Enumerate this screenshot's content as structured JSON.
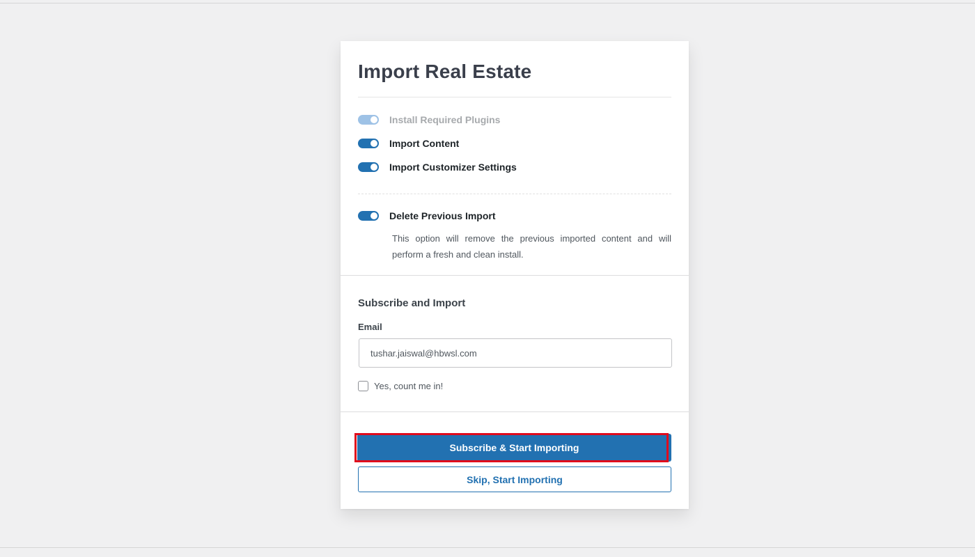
{
  "dialog": {
    "title": "Import Real Estate"
  },
  "options": [
    {
      "label": "Install Required Plugins",
      "enabled": true,
      "disabled": true
    },
    {
      "label": "Import Content",
      "enabled": true,
      "disabled": false
    },
    {
      "label": "Import Customizer Settings",
      "enabled": true,
      "disabled": false
    }
  ],
  "delete_previous": {
    "label": "Delete Previous Import",
    "enabled": true,
    "description": "This option will remove the previous imported content and will perform a fresh and clean install."
  },
  "subscribe": {
    "heading": "Subscribe and Import",
    "email_label": "Email",
    "email_value": "tushar.jaiswal@hbwsl.com",
    "consent_label": "Yes, count me in!",
    "consent_checked": false
  },
  "actions": {
    "primary_label": "Subscribe & Start Importing",
    "secondary_label": "Skip, Start Importing"
  },
  "colors": {
    "accent": "#2271b1",
    "highlight": "#e00b1c",
    "background": "#f0f0f1"
  }
}
